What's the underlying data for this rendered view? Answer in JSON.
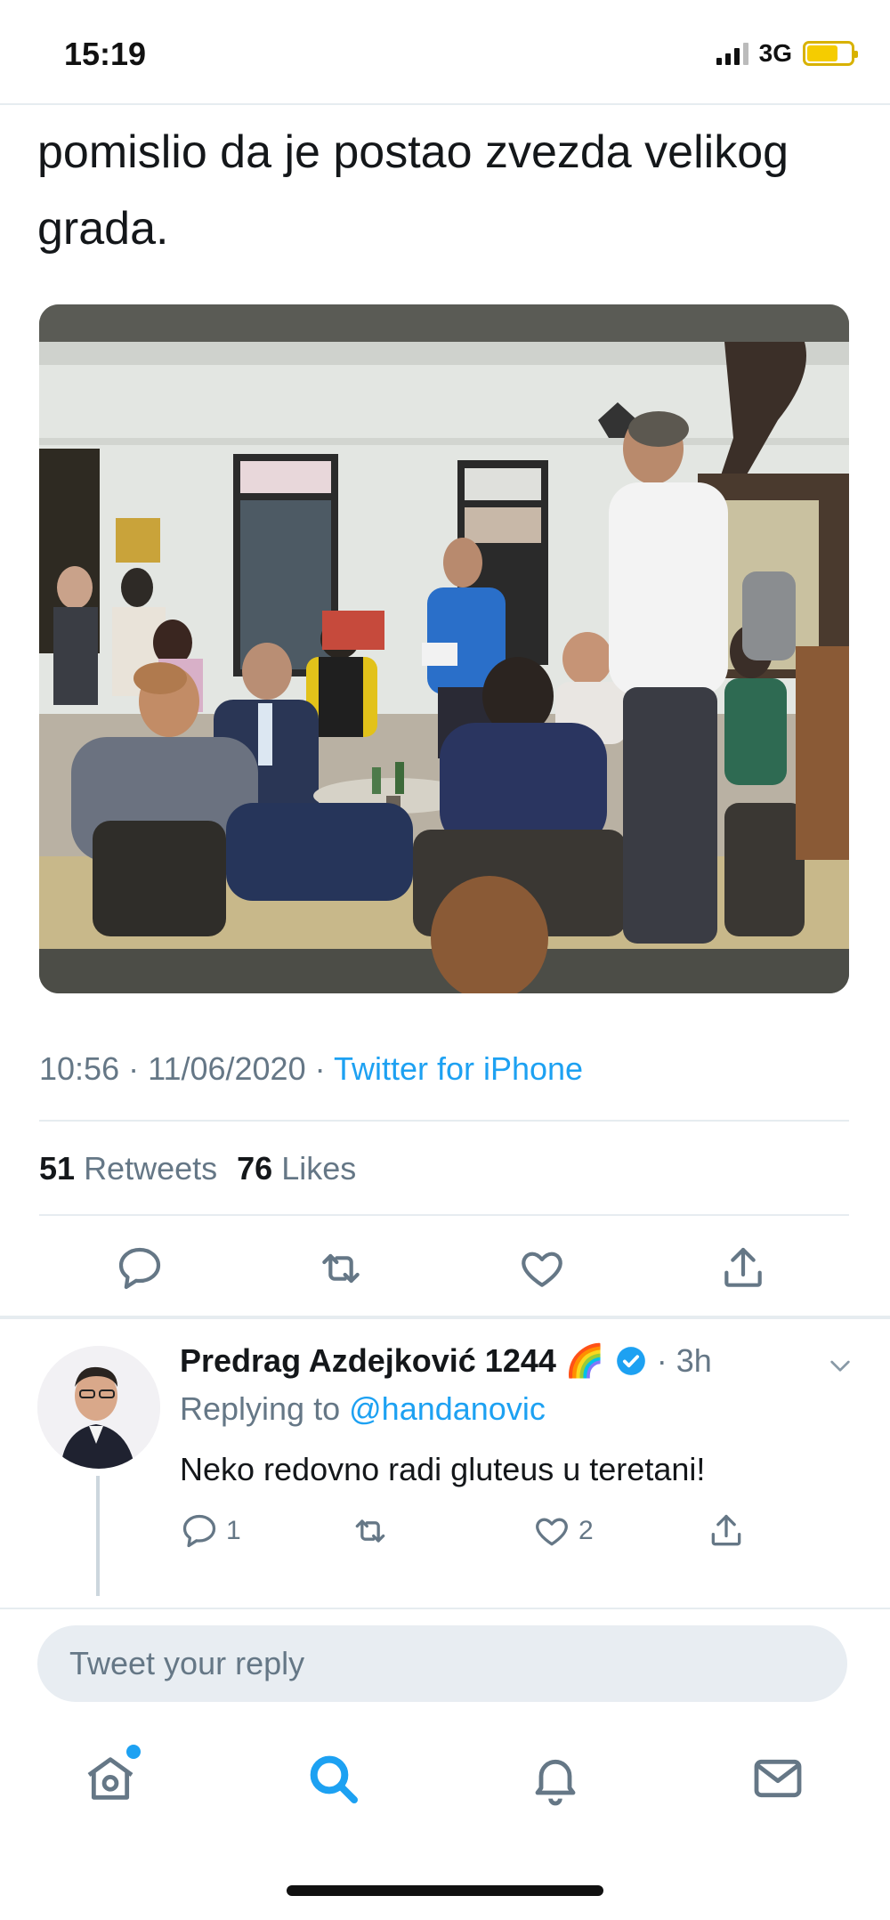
{
  "status_bar": {
    "time": "15:19",
    "network": "3G",
    "battery_level": 0.7,
    "battery_color": "#f5cc00"
  },
  "tweet": {
    "text": "pomislio da je postao zvezda velikog grada.",
    "image_icon": "photo-image",
    "meta": {
      "time": "10:56",
      "sep1": " · ",
      "date": "11/06/2020",
      "sep2": " · ",
      "source": "Twitter for iPhone"
    },
    "stats": {
      "retweets_count": "51",
      "retweets_label": "Retweets",
      "likes_count": "76",
      "likes_label": "Likes"
    },
    "actions": [
      "reply-icon",
      "retweet-icon",
      "like-icon",
      "share-icon"
    ]
  },
  "reply": {
    "author_name": "Predrag Azdejković 1244",
    "emoji": "🌈",
    "time": "· 3h",
    "replying_label": "Replying to",
    "replying_handle": "@handanovic",
    "text": "Neko redovno radi gluteus u teretani!",
    "reply_count": "1",
    "retweet_count": "",
    "like_count": "2"
  },
  "composer": {
    "placeholder": "Tweet your reply"
  },
  "tabbar": {
    "items": [
      "home-icon",
      "search-icon",
      "notifications-icon",
      "messages-icon"
    ],
    "active": "search-icon"
  },
  "colors": {
    "accent": "#1da1f2",
    "text": "#14171a",
    "muted": "#657786",
    "border": "#e6ecf0"
  }
}
